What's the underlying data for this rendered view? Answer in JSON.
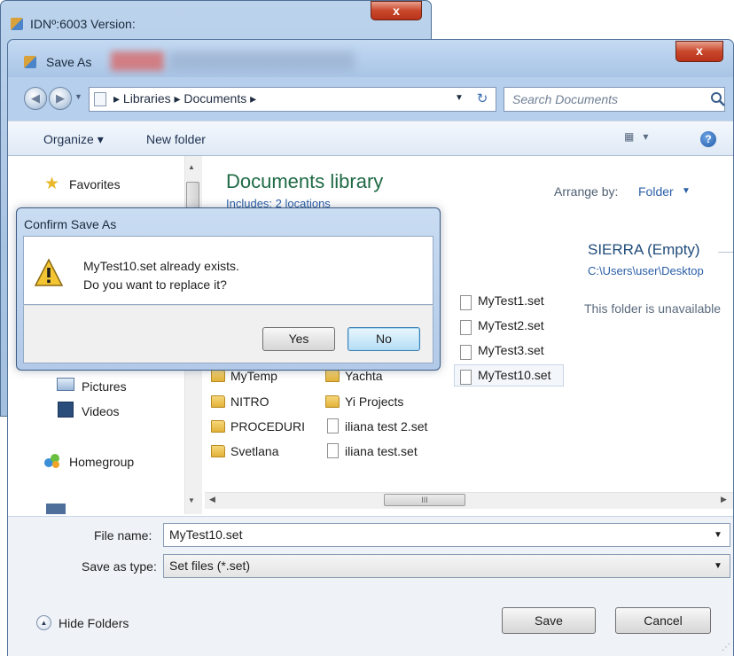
{
  "bg_window": {
    "title": "IDNº:6003 Version:",
    "close_label": "x"
  },
  "save_as": {
    "title": "Save As",
    "close_label": "x",
    "address": {
      "segments": "▸ Libraries ▸ Documents ▸"
    },
    "search": {
      "placeholder": "Search Documents"
    },
    "toolbar": {
      "organize": "Organize ▾",
      "new_folder": "New folder",
      "help": "?"
    },
    "nav": {
      "favorites": "Favorites",
      "pictures": "Pictures",
      "videos": "Videos",
      "homegroup": "Homegroup"
    },
    "library": {
      "title": "Documents library",
      "includes": "Includes: 2 locations",
      "arrange_label": "Arrange by:",
      "arrange_value": "Folder"
    },
    "location": {
      "name": "SIERRA (Empty)",
      "path": "C:\\Users\\user\\Desktop",
      "status": "This folder is unavailable"
    },
    "files": {
      "col1": [
        "MyTemp",
        "NITRO",
        "PROCEDURI",
        "Svetlana"
      ],
      "col2": [
        "Yachta",
        "Yi Projects",
        "iliana test 2.set",
        "iliana test.set"
      ],
      "col3": [
        "MyTest1.set",
        "MyTest2.set",
        "MyTest3.set",
        "MyTest10.set"
      ]
    },
    "hscroll_thumb": "III",
    "file_name_label": "File name:",
    "file_name_value": "MyTest10.set",
    "save_type_label": "Save as type:",
    "save_type_value": "Set files (*.set)",
    "hide_folders": "Hide Folders",
    "save_button": "Save",
    "cancel_button": "Cancel"
  },
  "confirm": {
    "title": "Confirm Save As",
    "line1": "MyTest10.set already exists.",
    "line2": "Do you want to replace it?",
    "yes": "Yes",
    "no": "No"
  },
  "colors": {
    "library_title": "#1f6a45",
    "link": "#2b5fa8",
    "close": "#c9472b"
  }
}
